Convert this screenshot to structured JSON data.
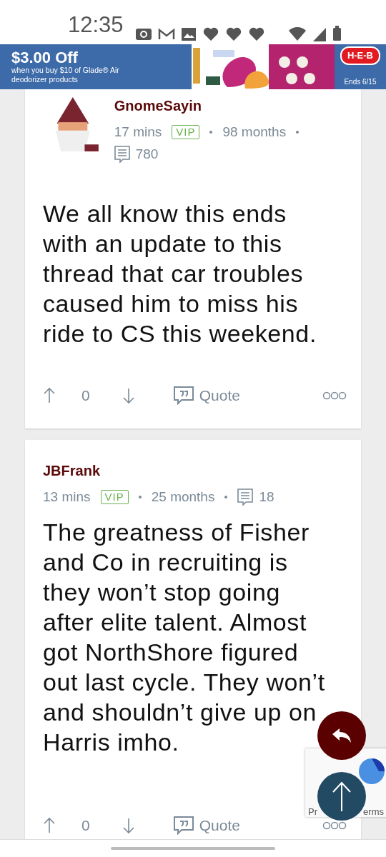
{
  "status_bar": {
    "time": "12:35"
  },
  "ad": {
    "headline": "$3.00 Off",
    "subtext": "when you buy $10 of Glade® Air deodorizer products",
    "brand": "H-E-B",
    "expiry": "Ends 6/15"
  },
  "posts": [
    {
      "author": "GnomeSayin",
      "has_avatar": true,
      "time": "17 mins",
      "badge": "VIP",
      "tenure": "98 months",
      "post_count": "780",
      "body": "We all know this ends with an update to this thread that car troubles caused him to miss his ride to CS this weekend.",
      "score": "0",
      "quote_label": "Quote"
    },
    {
      "author": "JBFrank",
      "has_avatar": false,
      "time": "13 mins",
      "badge": "VIP",
      "tenure": "25 months",
      "post_count": "18",
      "body": "The greatness of Fisher and Co in recruiting is they won’t stop going after elite talent. Almost got NorthShore figured out last cycle. They won’t and shouldn’t give up on Harris imho.",
      "score": "0",
      "quote_label": "Quote"
    }
  ],
  "recaptcha": {
    "texts": [
      "Pr",
      "erms"
    ]
  }
}
